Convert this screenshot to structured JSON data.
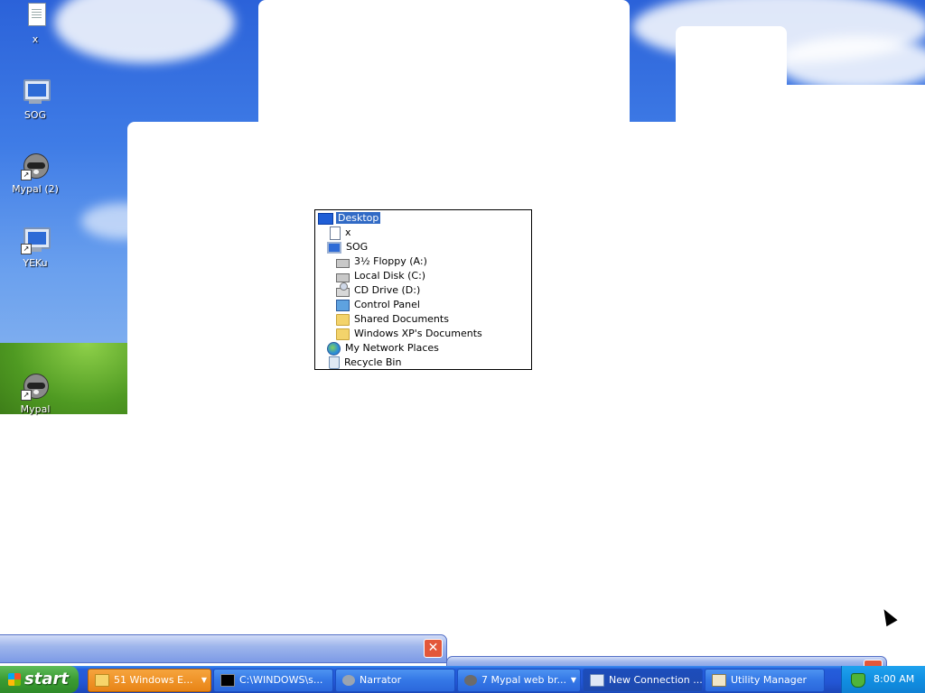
{
  "desktop_icons": [
    {
      "label": "x"
    },
    {
      "label": "SOG"
    },
    {
      "label": "Mypal (2)"
    },
    {
      "label": "YEKu"
    },
    {
      "label": "Mypal"
    }
  ],
  "tree": {
    "items": [
      {
        "label": "Desktop",
        "icon": "desktop-icon",
        "selected": true
      },
      {
        "label": "x",
        "icon": "document-icon"
      },
      {
        "label": "SOG",
        "icon": "computer-icon"
      },
      {
        "label": "3½ Floppy (A:)",
        "icon": "floppy-icon"
      },
      {
        "label": "Local Disk (C:)",
        "icon": "hard-disk-icon"
      },
      {
        "label": "CD Drive (D:)",
        "icon": "cd-drive-icon"
      },
      {
        "label": "Control Panel",
        "icon": "control-panel-icon"
      },
      {
        "label": "Shared Documents",
        "icon": "folder-icon"
      },
      {
        "label": "Windows XP's Documents",
        "icon": "folder-icon"
      },
      {
        "label": "My Network Places",
        "icon": "network-icon"
      },
      {
        "label": "Recycle Bin",
        "icon": "recycle-bin-icon"
      }
    ]
  },
  "taskbar": {
    "start_label": "start",
    "tasks": [
      {
        "label": "51 Windows E...",
        "has_arrow": true
      },
      {
        "label": "C:\\WINDOWS\\s..."
      },
      {
        "label": "Narrator"
      },
      {
        "label": "7 Mypal web br...",
        "has_arrow": true
      },
      {
        "label": "New Connection ..."
      },
      {
        "label": "Utility Manager"
      }
    ],
    "clock": "8:00 AM"
  },
  "close_glyph": "✕"
}
